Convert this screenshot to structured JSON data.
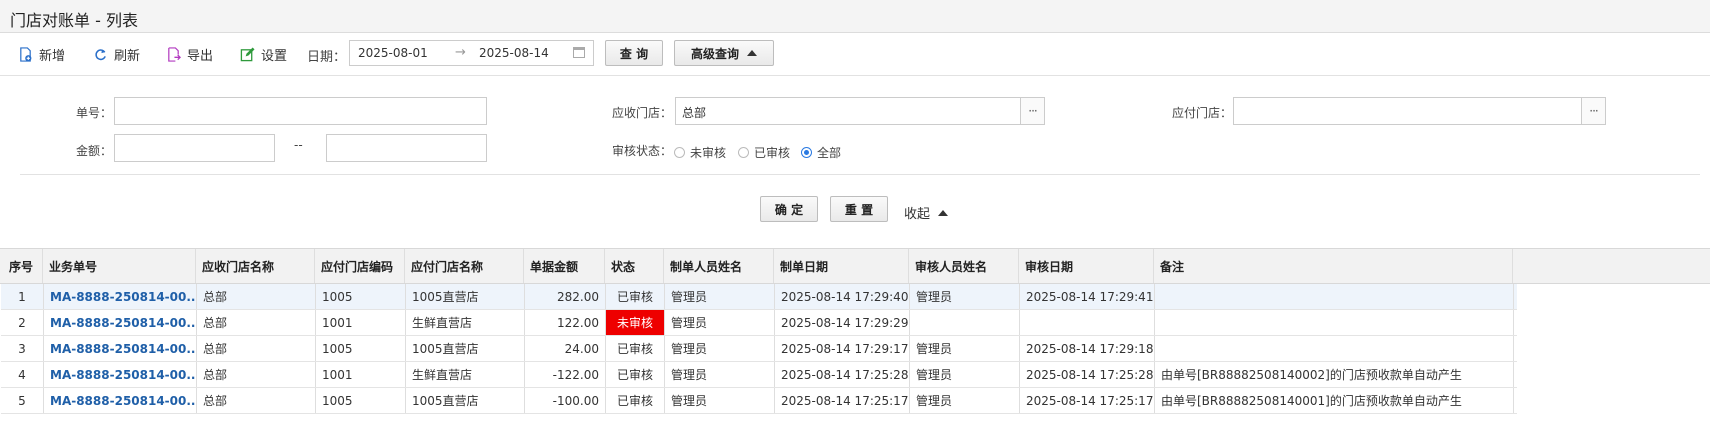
{
  "window": {
    "title": "门店对账单 - 列表"
  },
  "toolbar": {
    "add_label": "新增",
    "refresh_label": "刷新",
    "export_label": "导出",
    "settings_label": "设置",
    "date_label": "日期：",
    "date_from": "2025-08-01",
    "date_arrow": "→",
    "date_to": "2025-08-14",
    "query_label": "查 询",
    "advanced_label": "高级查询"
  },
  "filter": {
    "order_no_label": "单号：",
    "order_no_value": "",
    "receivable_store_label": "应收门店：",
    "receivable_store_value": "总部",
    "payable_store_label": "应付门店：",
    "payable_store_value": "",
    "amount_label": "金额：",
    "amount_from": "",
    "amount_sep": "--",
    "amount_to": "",
    "audit_status_label": "审核状态：",
    "audit_options": [
      "未审核",
      "已审核",
      "全部"
    ],
    "audit_selected": "全部",
    "ellipsis": "···",
    "confirm_label": "确 定",
    "reset_label": "重 置",
    "collapse_label": "收起"
  },
  "table": {
    "columns": [
      "序号",
      "业务单号",
      "应收门店名称",
      "应付门店编码",
      "应付门店名称",
      "单据金额",
      "状态",
      "制单人员姓名",
      "制单日期",
      "审核人员姓名",
      "审核日期",
      "备注"
    ],
    "rows": [
      [
        "1",
        "MA-8888-250814-00...",
        "总部",
        "1005",
        "1005直营店",
        "282.00",
        "已审核",
        "管理员",
        "2025-08-14 17:29:40",
        "管理员",
        "2025-08-14 17:29:41",
        ""
      ],
      [
        "2",
        "MA-8888-250814-00...",
        "总部",
        "1001",
        "生鲜直营店",
        "122.00",
        "未审核",
        "管理员",
        "2025-08-14 17:29:29",
        "",
        "",
        ""
      ],
      [
        "3",
        "MA-8888-250814-00...",
        "总部",
        "1005",
        "1005直营店",
        "24.00",
        "已审核",
        "管理员",
        "2025-08-14 17:29:17",
        "管理员",
        "2025-08-14 17:29:18",
        ""
      ],
      [
        "4",
        "MA-8888-250814-00...",
        "总部",
        "1001",
        "生鲜直营店",
        "-122.00",
        "已审核",
        "管理员",
        "2025-08-14 17:25:28",
        "管理员",
        "2025-08-14 17:25:28",
        "由单号[BR88882508140002]的门店预收款单自动产生"
      ],
      [
        "5",
        "MA-8888-250814-00...",
        "总部",
        "1005",
        "1005直营店",
        "-100.00",
        "已审核",
        "管理员",
        "2025-08-14 17:25:17",
        "管理员",
        "2025-08-14 17:25:17",
        "由单号[BR88882508140001]的门店预收款单自动产生"
      ]
    ],
    "selected_row": 0,
    "unaudited_color": "#ee0000"
  },
  "icons": {
    "add": "add-doc-icon",
    "refresh": "refresh-icon",
    "export": "export-icon",
    "settings": "edit-settings-icon",
    "calendar": "calendar-icon"
  }
}
